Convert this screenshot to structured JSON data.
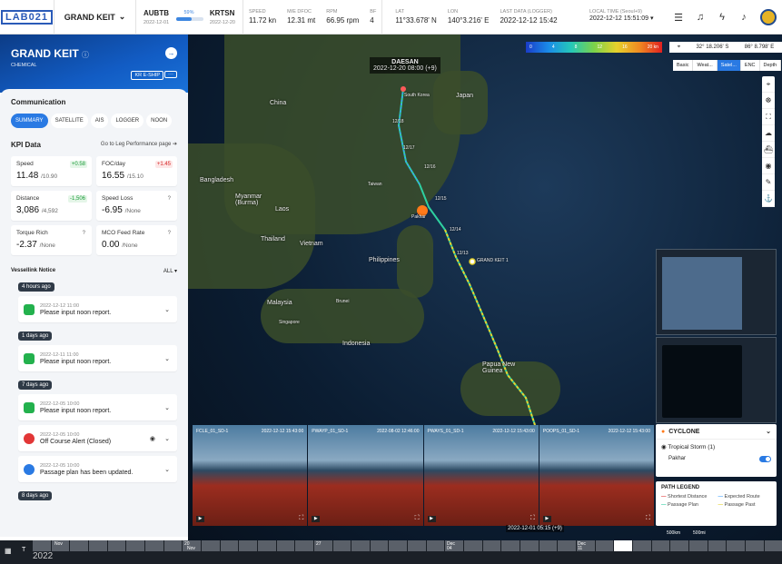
{
  "header": {
    "logo": "LAB021",
    "ship": "GRAND KEIT",
    "route": {
      "from": "AUBTB",
      "from_date": "2022-12-01",
      "to": "KRTSN",
      "to_date": "2022-12-20",
      "progress_pct": "59%",
      "progress": 0.59
    },
    "stats": [
      {
        "label": "SPEED",
        "value": "11.72 kn"
      },
      {
        "label": "M/E DFOC",
        "value": "12.31 mt"
      },
      {
        "label": "RPM",
        "value": "66.95 rpm"
      },
      {
        "label": "BF",
        "value": "4"
      },
      {
        "label": "LAT",
        "value": "11°33.678' N"
      },
      {
        "label": "LON",
        "value": "140°3.216' E"
      },
      {
        "label": "LAST DATA (LOGGER)",
        "value": "2022-12-12 15:42"
      }
    ],
    "local_time_label": "LOCAL TIME (Seoul+9)",
    "local_time": "2022-12-12 15:51:09"
  },
  "side": {
    "ship_name": "GRAND KEIT",
    "ship_type": "CHEMICAL",
    "tag": "KR E-SHIP",
    "more": "···",
    "communication": "Communication",
    "tabs": [
      "SUMMARY",
      "SATELLITE",
      "AIS",
      "LOGGER",
      "NOON"
    ],
    "kpi_title": "KPI Data",
    "kpi_link": "Go to Leg Performance page",
    "kpis": [
      {
        "t": "Speed",
        "v": "11.48",
        "s": "/10.90",
        "d": "+0.58"
      },
      {
        "t": "FOC/day",
        "v": "16.55",
        "s": "/15.10",
        "d": "+1.45"
      },
      {
        "t": "Distance",
        "v": "3,086",
        "s": "/4,592",
        "d": "-1,506"
      },
      {
        "t": "Speed Loss",
        "v": "-6.95",
        "s": "/None",
        "d": "?"
      },
      {
        "t": "Torque Rich",
        "v": "-2.37",
        "s": "/None",
        "d": "?"
      },
      {
        "t": "MCO Feed Rate",
        "v": "0.00",
        "s": "/None",
        "d": "?"
      }
    ],
    "notice_title": "Vessellink Notice",
    "notice_filter": "ALL",
    "groups": [
      {
        "ago": "4 hours ago",
        "items": [
          {
            "dt": "2022-12-12 11:00",
            "tx": "Please input noon report."
          }
        ]
      },
      {
        "ago": "1 days ago",
        "items": [
          {
            "dt": "2022-12-11 11:00",
            "tx": "Please input noon report."
          }
        ]
      },
      {
        "ago": "7 days ago",
        "items": [
          {
            "dt": "2022-12-05 10:00",
            "tx": "Please input noon report."
          },
          {
            "dt": "2022-12-05 10:00",
            "tx": "Off Course Alert (Closed)"
          },
          {
            "dt": "2022-12-05 10:00",
            "tx": "Passage plan has been updated."
          }
        ]
      },
      {
        "ago": "8 days ago",
        "items": []
      }
    ]
  },
  "map": {
    "scale": [
      "0",
      "4",
      "8",
      "12",
      "16",
      "20 kn"
    ],
    "coord_lat": "32° 18.206' S",
    "coord_lon": "86° 8.798' E",
    "layer_tabs": [
      "Basic",
      "Weat...",
      "Satel...",
      "ENC",
      "Depth"
    ],
    "labels": [
      "China",
      "Japan",
      "Bangladesh",
      "Myanmar (Burma)",
      "Laos",
      "Thailand",
      "Vietnam",
      "Philippines",
      "Malaysia",
      "Indonesia",
      "Papua New Guinea",
      "Taiwan",
      "South Korea",
      "Brunei",
      "Singapore"
    ],
    "dest_label": "DAESAN",
    "dest_eta": "2022-12-20 08:00 (+9)",
    "ship_label": "GRAND KEIT 1",
    "cyclone_label": "Pakhar",
    "track_dates": [
      "12/18",
      "12/17",
      "12/16",
      "12/15",
      "12/14",
      "12/13"
    ],
    "cameras": [
      {
        "n": "FCLE_01_SD-1",
        "t": "2022-12-12 15:43:00"
      },
      {
        "n": "PWAYP_01_SD-1",
        "t": "2022-08-02 12:46:00"
      },
      {
        "n": "PWAYS_01_SD-1",
        "t": "2022-12-12 15:43:00"
      },
      {
        "n": "POOPS_01_SD-1",
        "t": "2022-12-12 15:43:00"
      }
    ],
    "cyclone_title": "CYCLONE",
    "storm": "Tropical Storm",
    "storm_count": "(1)",
    "pakhar": "Pakhar",
    "legend_title": "PATH LEGEND",
    "legend": [
      "Shortest Distance",
      "Expected Route",
      "Passage Plan",
      "Passage Past"
    ],
    "scale_km": [
      "500km",
      "500mi"
    ],
    "current_time": "2022-12-01 05:15 (+9)"
  },
  "timeline": {
    "year": "2022",
    "months": [
      "Nov",
      "20",
      "Nov",
      "27",
      "Dec",
      "04",
      "Dec",
      "11"
    ]
  }
}
